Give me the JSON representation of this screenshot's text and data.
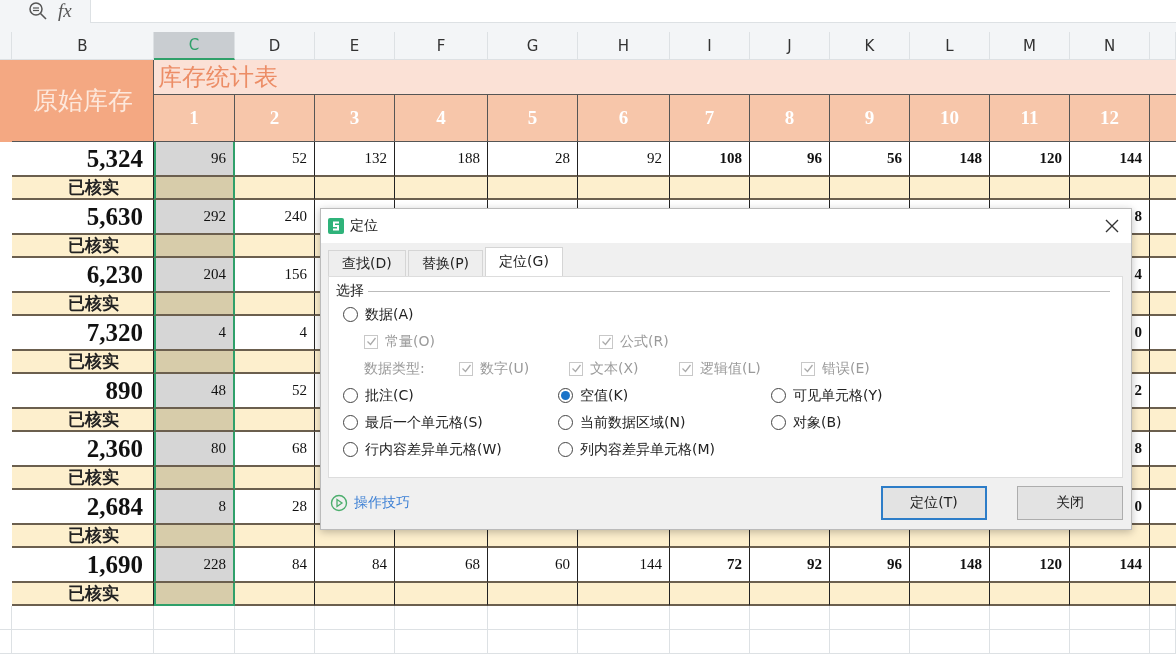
{
  "formula_bar": {
    "function_label": "fx"
  },
  "sheet": {
    "stock_column": {
      "letter": "B",
      "title": "原始库存"
    },
    "table_title": "库存统计表",
    "columns": [
      {
        "letter": "C",
        "period": "1",
        "selected": true,
        "bold": false
      },
      {
        "letter": "D",
        "period": "2",
        "selected": false,
        "bold": false
      },
      {
        "letter": "E",
        "period": "3",
        "selected": false,
        "bold": false
      },
      {
        "letter": "F",
        "period": "4",
        "selected": false,
        "bold": false
      },
      {
        "letter": "G",
        "period": "5",
        "selected": false,
        "bold": false
      },
      {
        "letter": "H",
        "period": "6",
        "selected": false,
        "bold": false
      },
      {
        "letter": "I",
        "period": "7",
        "selected": false,
        "bold": true
      },
      {
        "letter": "J",
        "period": "8",
        "selected": false,
        "bold": true
      },
      {
        "letter": "K",
        "period": "9",
        "selected": false,
        "bold": true
      },
      {
        "letter": "L",
        "period": "10",
        "selected": false,
        "bold": true
      },
      {
        "letter": "M",
        "period": "11",
        "selected": false,
        "bold": true
      },
      {
        "letter": "N",
        "period": "12",
        "selected": false,
        "bold": true
      }
    ],
    "rows": [
      {
        "total": "5,324",
        "status": "已核实",
        "values": [
          "96",
          "52",
          "132",
          "188",
          "28",
          "92",
          "108",
          "96",
          "56",
          "148",
          "120",
          "144"
        ]
      },
      {
        "total": "5,630",
        "status": "已核实",
        "values": [
          "292",
          "240"
        ],
        "tail_value": "8"
      },
      {
        "total": "6,230",
        "status": "已核实",
        "values": [
          "204",
          "156"
        ],
        "tail_value": "4"
      },
      {
        "total": "7,320",
        "status": "已核实",
        "values": [
          "4",
          "4"
        ],
        "tail_value": "0"
      },
      {
        "total": "890",
        "status": "已核实",
        "values": [
          "48",
          "52"
        ],
        "tail_value": "2"
      },
      {
        "total": "2,360",
        "status": "已核实",
        "values": [
          "80",
          "68"
        ],
        "tail_value": "8"
      },
      {
        "total": "2,684",
        "status": "已核实",
        "values": [
          "8",
          "28"
        ],
        "tail_value": "0"
      },
      {
        "total": "1,690",
        "status": "已核实",
        "values": [
          "228",
          "84",
          "84",
          "68",
          "60",
          "144",
          "72",
          "92",
          "96",
          "148",
          "120",
          "144"
        ]
      }
    ]
  },
  "dialog": {
    "title": "定位",
    "tabs": [
      {
        "label": "查找(D)",
        "selected": false
      },
      {
        "label": "替换(P)",
        "selected": false
      },
      {
        "label": "定位(G)",
        "selected": true
      }
    ],
    "group_label": "选择",
    "data_option": {
      "label": "数据(A)",
      "selected": false
    },
    "formula_kinds": [
      {
        "label": "常量(O)",
        "checked": true,
        "disabled": true
      },
      {
        "label": "公式(R)",
        "checked": true,
        "disabled": true
      }
    ],
    "data_types_label": "数据类型:",
    "data_types": [
      {
        "label": "数字(U)",
        "checked": true,
        "disabled": true
      },
      {
        "label": "文本(X)",
        "checked": true,
        "disabled": true
      },
      {
        "label": "逻辑值(L)",
        "checked": true,
        "disabled": true
      },
      {
        "label": "错误(E)",
        "checked": true,
        "disabled": true
      }
    ],
    "options": [
      {
        "label": "批注(C)",
        "selected": false
      },
      {
        "label": "空值(K)",
        "selected": true
      },
      {
        "label": "可见单元格(Y)",
        "selected": false
      },
      {
        "label": "最后一个单元格(S)",
        "selected": false
      },
      {
        "label": "当前数据区域(N)",
        "selected": false
      },
      {
        "label": "对象(B)",
        "selected": false
      },
      {
        "label": "行内容差异单元格(W)",
        "selected": false
      },
      {
        "label": "列内容差异单元格(M)",
        "selected": false
      }
    ],
    "tips_link": "操作技巧",
    "buttons": [
      {
        "label": "定位(T)",
        "default": true
      },
      {
        "label": "关闭",
        "default": false
      }
    ]
  }
}
